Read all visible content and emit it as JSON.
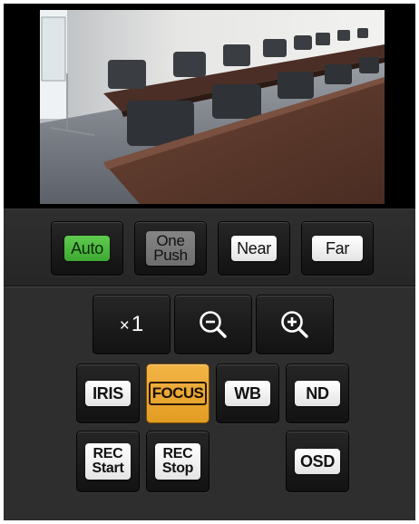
{
  "focus_controls": {
    "auto_label": "Auto",
    "one_push_line1": "One",
    "one_push_line2": "Push",
    "near_label": "Near",
    "far_label": "Far"
  },
  "zoom_controls": {
    "zoom_level": "1",
    "zoom_level_prefix": "×",
    "zoom_out_icon": "zoom-out-icon",
    "zoom_in_icon": "zoom-in-icon"
  },
  "mode_buttons": {
    "iris_label": "IRIS",
    "focus_label": "FOCUS",
    "wb_label": "WB",
    "nd_label": "ND",
    "rec_start_line1": "REC",
    "rec_start_line2": "Start",
    "rec_stop_line1": "REC",
    "rec_stop_line2": "Stop",
    "osd_label": "OSD"
  },
  "colors": {
    "auto_active": "#4cbb3e",
    "focus_active": "#eaa533",
    "panel": "#2e2e2e",
    "button_face": "#1a1a1a"
  }
}
